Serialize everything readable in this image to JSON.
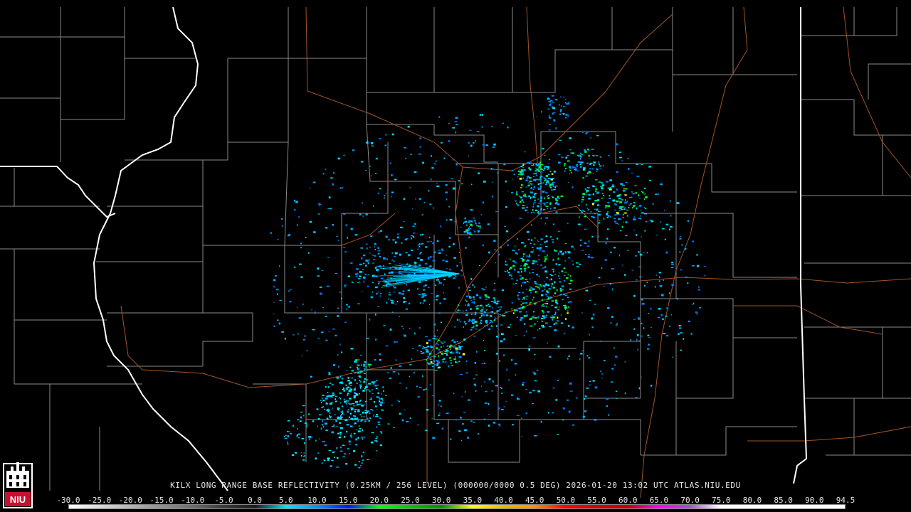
{
  "radar": {
    "title": "KILX LONG RANGE BASE REFLECTIVITY (0.25KM / 256 LEVEL) (000000/0000 0.5 DEG) 2026-01-20 13:02 UTC  ATLAS.NIU.EDU",
    "station": "KILX",
    "product": "LONG RANGE BASE REFLECTIVITY",
    "elevation_deg": 0.5,
    "valid_time": "2026-01-20 13:02 UTC",
    "source": "ATLAS.NIU.EDU"
  },
  "colorbar": {
    "labels": [
      "-30.0",
      "-25.0",
      "-20.0",
      "-15.0",
      "-10.0",
      "-5.0",
      "0.0",
      "5.0",
      "10.0",
      "15.0",
      "20.0",
      "25.0",
      "30.0",
      "35.0",
      "40.0",
      "45.0",
      "50.0",
      "55.0",
      "60.0",
      "65.0",
      "70.0",
      "75.0",
      "80.0",
      "85.0",
      "90.0",
      "94.5"
    ],
    "colors": [
      "#ffffff",
      "#d8d8d8",
      "#b4b4b4",
      "#909090",
      "#6c6c6c",
      "#3a3a3a",
      "#1b1b1b",
      "#00e4ff",
      "#0094ff",
      "#0018ff",
      "#00ff00",
      "#00c800",
      "#009000",
      "#ffff00",
      "#e6b800",
      "#ff9000",
      "#ff0000",
      "#d40000",
      "#c00000",
      "#ff00ff",
      "#9955c9",
      "#ffffff",
      "#ffffff",
      "#ffffff",
      "#ffffff",
      "#ffffff"
    ]
  },
  "logo": {
    "text": "NIU",
    "color": "#c8102e"
  }
}
